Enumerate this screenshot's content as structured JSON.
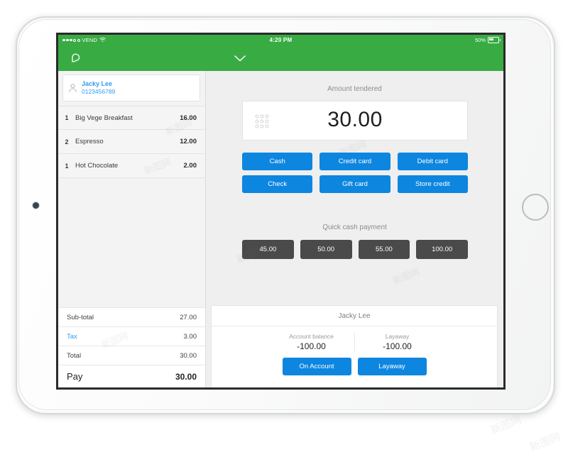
{
  "device": {
    "name": "ipad-tablet-frame",
    "home_button": "home-button",
    "camera": "front-camera"
  },
  "status_bar": {
    "carrier": "VEND",
    "signal_filled": 3,
    "signal_empty": 2,
    "wifi_icon": "wifi-icon",
    "time": "4:20 PM",
    "battery_percent": "50%",
    "battery_icon": "battery-icon"
  },
  "navbar": {
    "back_icon": "undo-back-icon",
    "chevron_icon": "chevron-down-icon"
  },
  "cart": {
    "customer": {
      "icon": "person-icon",
      "name": "Jacky Lee",
      "phone": "0123456789"
    },
    "items": [
      {
        "qty": "1",
        "name": "Big Vege Breakfast",
        "price": "16.00"
      },
      {
        "qty": "2",
        "name": "Espresso",
        "price": "12.00"
      },
      {
        "qty": "1",
        "name": "Hot Chocolate",
        "price": "2.00"
      }
    ],
    "totals": [
      {
        "label": "Sub-total",
        "value": "27.00"
      },
      {
        "label": "Tax",
        "value": "3.00"
      },
      {
        "label": "Total",
        "value": "30.00"
      }
    ],
    "pay": {
      "label": "Pay",
      "value": "30.00"
    }
  },
  "payment": {
    "tendered_label": "Amount tendered",
    "tendered_value": "30.00",
    "keypad_icon": "keypad-grid-icon",
    "methods": [
      "Cash",
      "Credit card",
      "Debit card",
      "Check",
      "Gift card",
      "Store credit"
    ],
    "quick_cash_label": "Quick cash payment",
    "quick_cash": [
      "45.00",
      "50.00",
      "55.00",
      "100.00"
    ]
  },
  "account": {
    "customer_name": "Jacky Lee",
    "stats": [
      {
        "label": "Account balance",
        "value": "-100.00"
      },
      {
        "label": "Layaway",
        "value": "-100.00"
      }
    ],
    "actions": [
      "On Account",
      "Layaway"
    ]
  },
  "watermarks": [
    "新图网",
    "新图网",
    "新图网",
    "新图网",
    "新图网",
    "新图网",
    "新图网",
    "新图网"
  ],
  "colors": {
    "brand_green": "#38ab43",
    "accent_blue": "#0d86e0",
    "link_blue": "#2f9cf4",
    "quick_cash_gray": "#4a4a4a",
    "screen_bg": "#efefef"
  }
}
